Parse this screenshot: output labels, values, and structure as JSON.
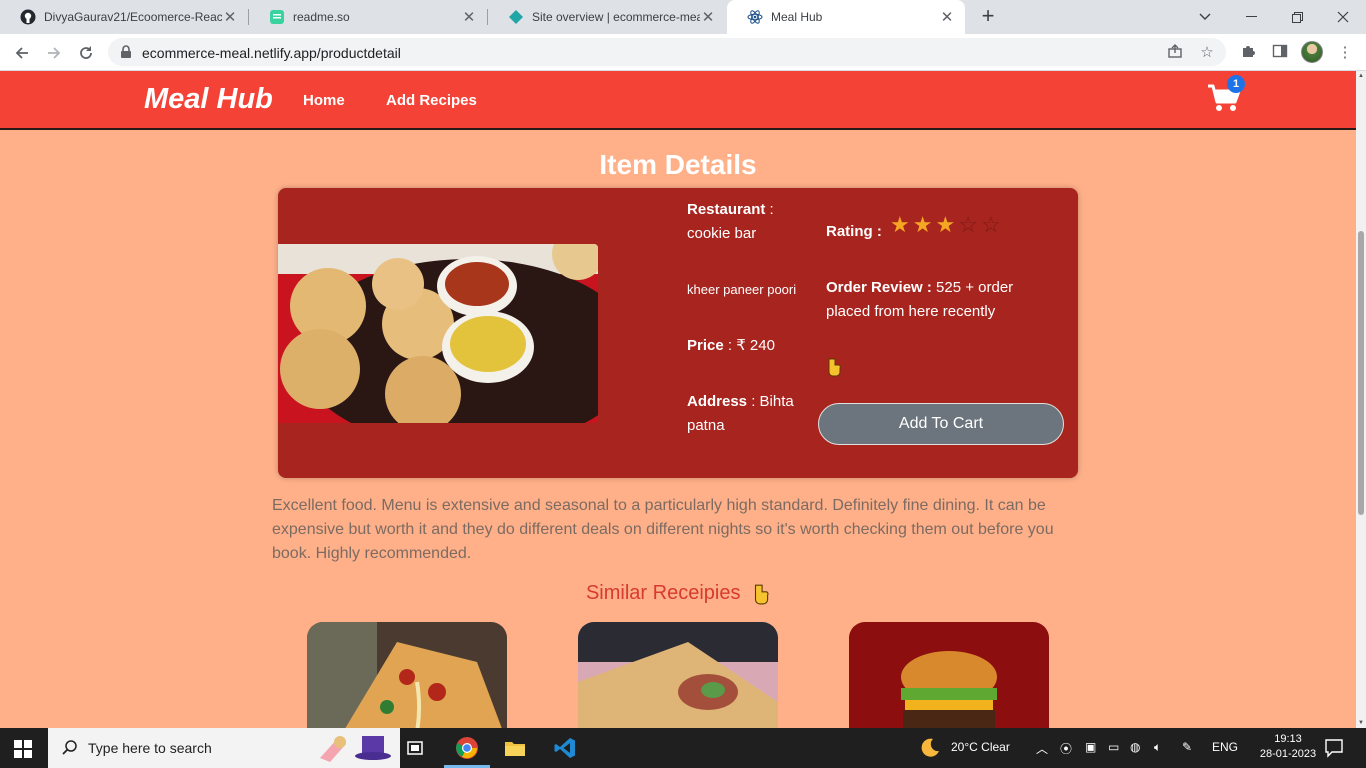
{
  "browser": {
    "tabs": [
      {
        "title": "DivyaGaurav21/Ecoomerce-React",
        "icon": "github-icon",
        "active": false
      },
      {
        "title": "readme.so",
        "icon": "readme-icon",
        "active": false
      },
      {
        "title": "Site overview | ecommerce-meal",
        "icon": "netlify-icon",
        "active": false
      },
      {
        "title": "Meal Hub",
        "icon": "react-icon",
        "active": true
      }
    ],
    "url": "ecommerce-meal.netlify.app/productdetail"
  },
  "navbar": {
    "brand": "Meal Hub",
    "links": [
      "Home",
      "Add Recipes"
    ],
    "cart_count": "1"
  },
  "page": {
    "title": "Item Details",
    "item": {
      "restaurant_label": "Restaurant",
      "restaurant_sep": " :",
      "restaurant": "cookie bar",
      "name": "kheer paneer poori",
      "price_label": "Price",
      "price": " : ₹ 240",
      "address_label": "Address",
      "address": " : Bihta patna",
      "rating_label": "Rating :",
      "rating": 3,
      "rating_max": 5,
      "order_review_label": "Order Review :",
      "order_review": " 525 + order placed from here recently",
      "add_to_cart": "Add To Cart"
    },
    "review_text": "Excellent food. Menu is extensive and seasonal to a particularly high standard. Definitely fine dining. It can be expensive but worth it and they do different deals on different nights so it's worth checking them out before you book. Highly recommended.",
    "similar_title": "Similar Receipies",
    "similar_items": [
      "pizza",
      "wrap",
      "burger"
    ]
  },
  "taskbar": {
    "search_placeholder": "Type here to search",
    "weather": "20°C  Clear",
    "language": "ENG",
    "time": "19:13",
    "date": "28-01-2023"
  },
  "colors": {
    "navbar": "#f44336",
    "page_bg": "#ffb089",
    "card": "#a8241e",
    "button": "#6c757d",
    "star": "#f5a623",
    "similar_title": "#d73a30"
  }
}
